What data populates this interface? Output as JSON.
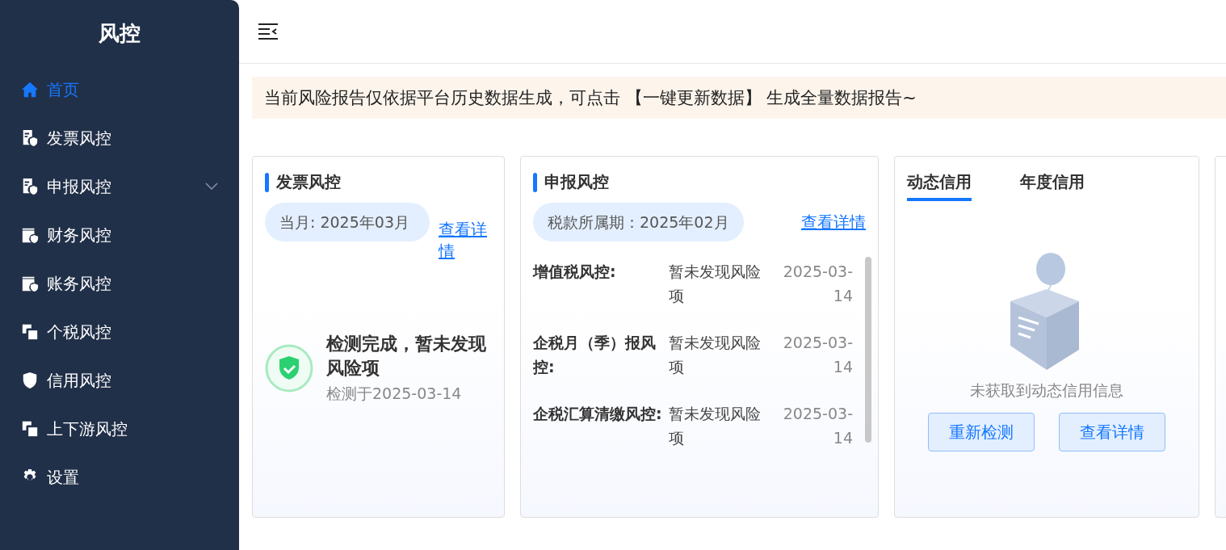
{
  "sidebar": {
    "title": "风控",
    "items": [
      {
        "label": "首页",
        "kind": "home",
        "selected": true,
        "has_children": false
      },
      {
        "label": "发票风控",
        "kind": "doc",
        "selected": false,
        "has_children": false
      },
      {
        "label": "申报风控",
        "kind": "doc",
        "selected": false,
        "has_children": true
      },
      {
        "label": "财务风控",
        "kind": "wallet",
        "selected": false,
        "has_children": false
      },
      {
        "label": "账务风控",
        "kind": "wallet",
        "selected": false,
        "has_children": false
      },
      {
        "label": "个税风控",
        "kind": "link",
        "selected": false,
        "has_children": false
      },
      {
        "label": "信用风控",
        "kind": "shield",
        "selected": false,
        "has_children": false
      },
      {
        "label": "上下游风控",
        "kind": "link",
        "selected": false,
        "has_children": false
      },
      {
        "label": "设置",
        "kind": "gear",
        "selected": false,
        "has_children": false
      }
    ]
  },
  "notice": "当前风险报告仅依据平台历史数据生成，可点击 【一键更新数据】 生成全量数据报告~",
  "invoice_card": {
    "title": "发票风控",
    "period": "当月: 2025年03月",
    "link": "查看详情",
    "result": "检测完成，暂未发现风险项",
    "checked_at": "检测于2025-03-14"
  },
  "declaration_card": {
    "title": "申报风控",
    "period": "税款所属期：2025年02月",
    "link": "查看详情",
    "rows": [
      {
        "label": "增值税风控:",
        "status": "暂未发现风险项",
        "date": "2025-03-14"
      },
      {
        "label": "企税月（季）报风控:",
        "status": "暂未发现风险项",
        "date": "2025-03-14"
      },
      {
        "label": "企税汇算清缴风控:",
        "status": "暂未发现风险项",
        "date": "2025-03-14"
      }
    ]
  },
  "credit_card": {
    "tabs": [
      {
        "label": "动态信用",
        "selected": true
      },
      {
        "label": "年度信用",
        "selected": false
      }
    ],
    "empty_text": "未获取到动态信用信息",
    "buttons": [
      "重新检测",
      "查看详情"
    ]
  }
}
